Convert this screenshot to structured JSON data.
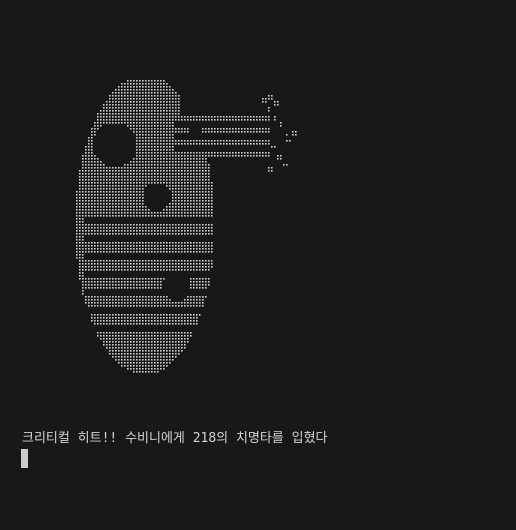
{
  "terminal": {
    "background": "#181818",
    "text_color": "#d4d4d4",
    "art_description_icon": "hand-holding-axe-dot-art",
    "message": "크리티컬 히트!! 수비니에게 218의 치명타를 입혔다",
    "cursor_icon": "block-cursor"
  }
}
